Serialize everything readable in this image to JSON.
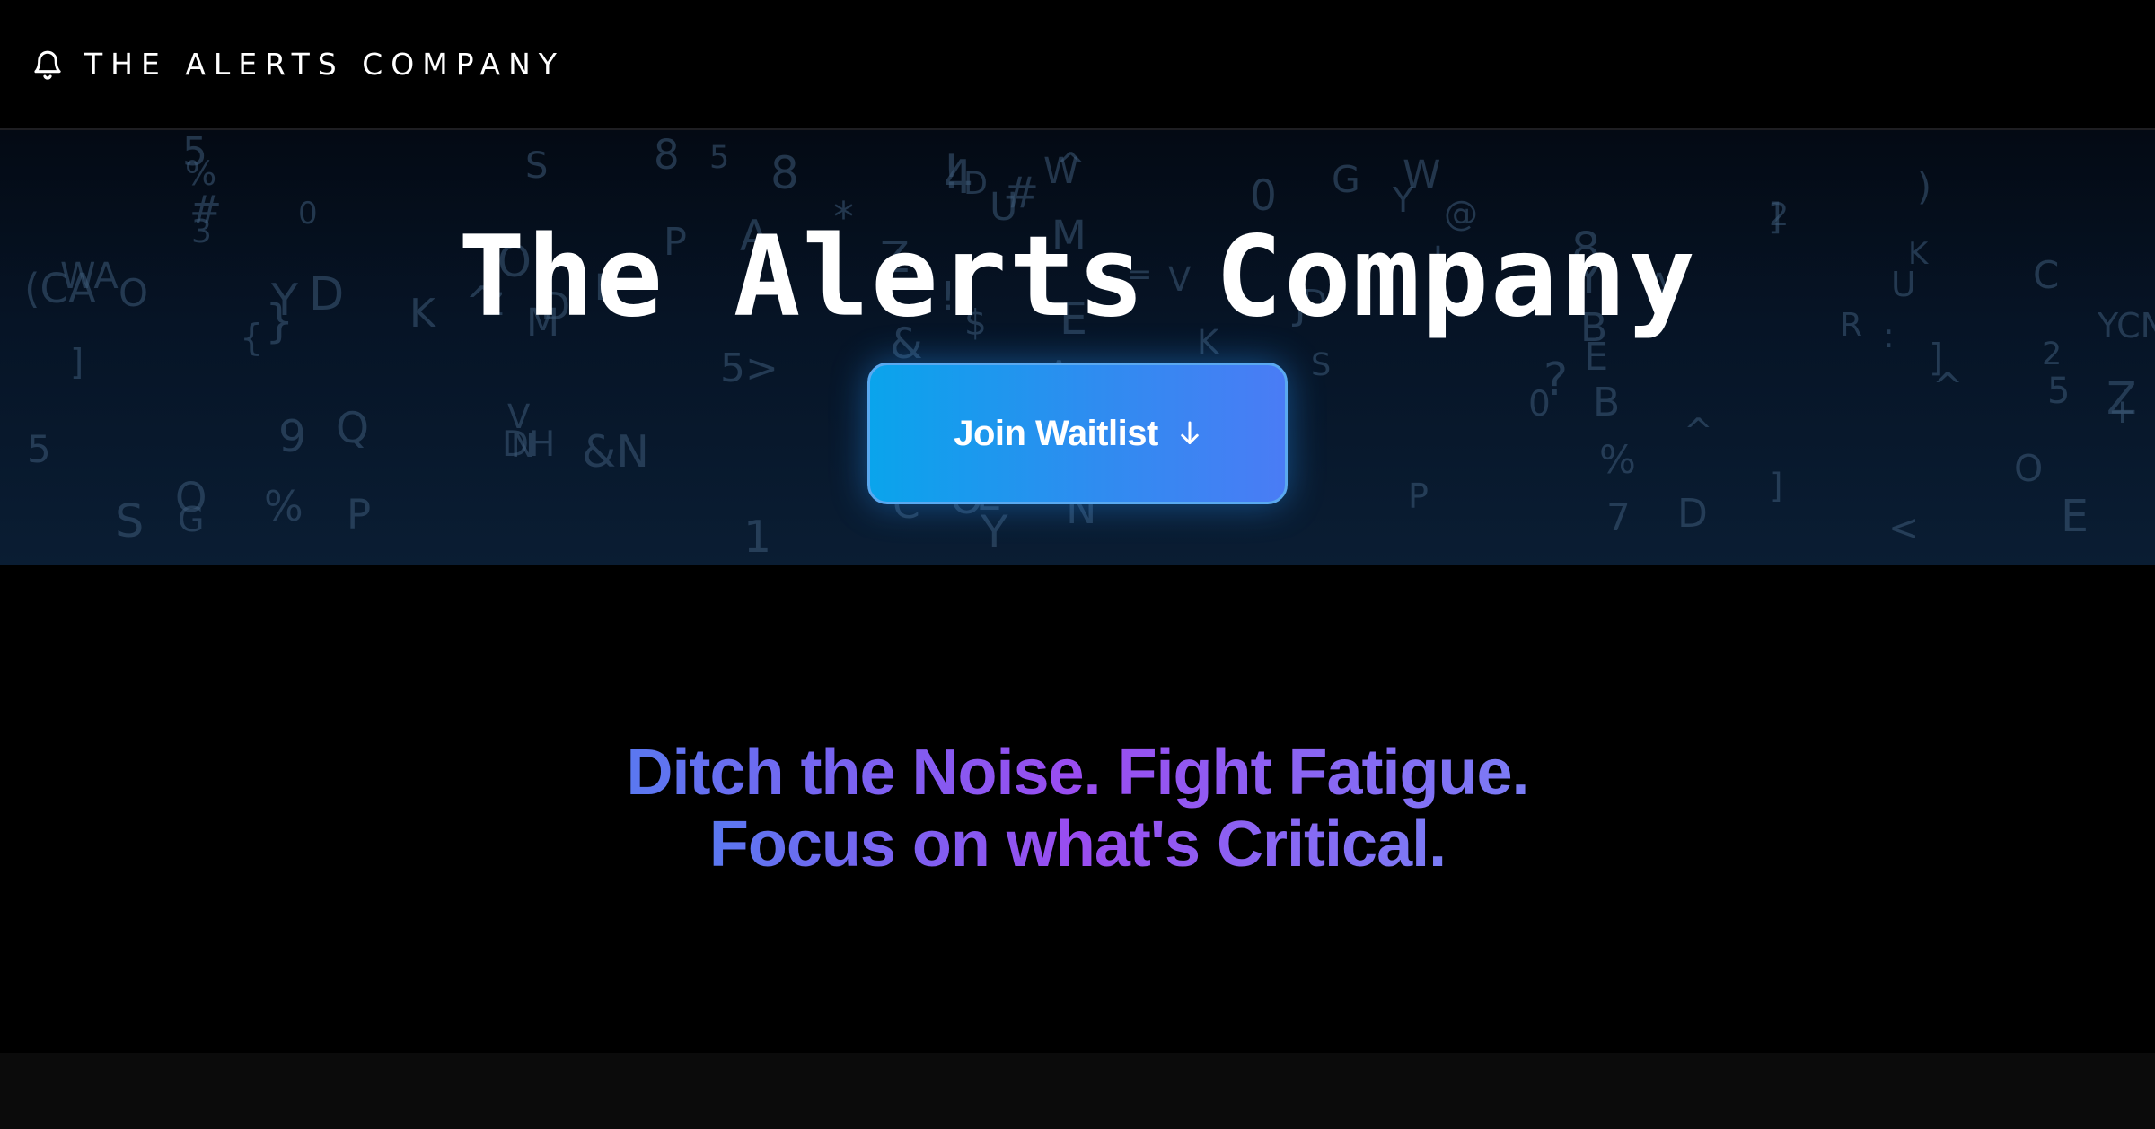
{
  "header": {
    "brand_name": "THE ALERTS COMPANY",
    "brand_icon": "bell-icon"
  },
  "hero": {
    "title": "The Alerts Company",
    "cta_label": "Join Waitlist",
    "cta_icon": "arrow-down-icon",
    "background_glyphs": [
      "A",
      "M",
      "O",
      "Z",
      "W",
      "V",
      "K",
      "S",
      "}",
      "K",
      "J",
      "YCN",
      "V",
      "A",
      "G",
      ":",
      "}",
      "Y",
      "D",
      "O",
      "C",
      "E",
      "$",
      "N",
      "&N",
      "E",
      "B",
      "WA",
      "^",
      "8",
      "(CA",
      "4",
      "E",
      "#",
      "K",
      "Q",
      "P",
      "2",
      "5",
      "]",
      "^",
      "W",
      "O",
      "0",
      "G",
      "{",
      "5",
      "Y",
      "0",
      "8",
      "%",
      "8",
      "!",
      "]",
      "%",
      "N",
      "Y",
      "&",
      "D",
      "Z",
      "!",
      "P",
      "%",
      "O",
      "O",
      "+",
      "@",
      "=",
      "2",
      "*",
      "DH",
      "^",
      "]",
      "C",
      "#",
      "D",
      "5",
      "B",
      ")",
      "Z",
      "9",
      "]",
      "A",
      "M",
      "<",
      "O",
      "3",
      "?",
      "E",
      "P",
      "^",
      "0",
      "5",
      "5>",
      "Y",
      "E",
      "D",
      "D",
      "7",
      "R",
      "U",
      "S",
      "1",
      "S",
      "U",
      "P"
    ],
    "colors": {
      "title": "#ffffff",
      "cta_start": "#0aa4ec",
      "cta_end": "#4a7cf5"
    }
  },
  "tagline": {
    "line1": "Ditch the Noise. Fight Fatigue.",
    "line2": "Focus on what's Critical.",
    "gradient_start": "#5a78f0",
    "gradient_mid": "#9a4cf0",
    "gradient_end": "#7a7cf5"
  }
}
